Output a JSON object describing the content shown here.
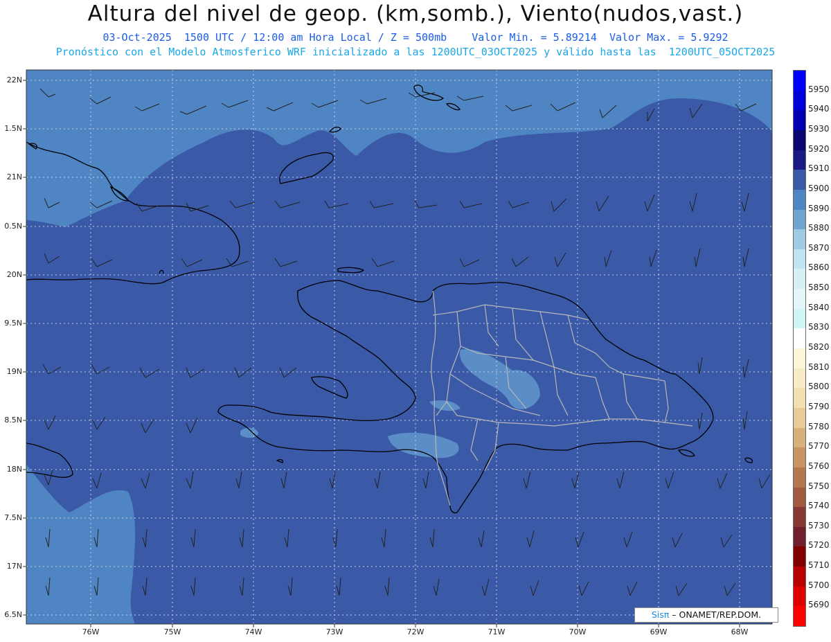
{
  "header": {
    "title": "Altura del nivel de geop. (km,somb.), Viento(nudos,vast.)",
    "subtitle_line1": "03-Oct-2025  1500 UTC / 12:00 am Hora Local / Z = 500mb    Valor Min. = 5.89214  Valor Max. = 5.9292",
    "subtitle_line2": "Pronóstico con el Modelo Atmosferico WRF inicializado a las 1200UTC_03OCT2025 y válido hasta las  1200UTC_05OCT2025"
  },
  "map": {
    "lat_labels": [
      "22N",
      "1.5N",
      "21N",
      "0.5N",
      "20N",
      "9.5N",
      "19N",
      "8.5N",
      "18N",
      "7.5N",
      "17N",
      "6.5N"
    ],
    "lon_labels": [
      "76W",
      "75W",
      "74W",
      "73W",
      "72W",
      "71W",
      "70W",
      "69W",
      "68W"
    ],
    "background_color": "#3a5aa8",
    "high_color": "#4f85c2",
    "pocket_color": "#5b8ec6",
    "coastline_color": "#000000",
    "province_border_color": "#b8b8b8"
  },
  "colorbar": {
    "labels": [
      "5950",
      "5940",
      "5930",
      "5920",
      "5910",
      "5900",
      "5890",
      "5880",
      "5870",
      "5860",
      "5850",
      "5840",
      "5830",
      "5820",
      "5810",
      "5800",
      "5790",
      "5780",
      "5770",
      "5760",
      "5750",
      "5740",
      "5730",
      "5720",
      "5710",
      "5700",
      "5690"
    ],
    "colors": [
      "#0000ff",
      "#0000d8",
      "#0000b0",
      "#080870",
      "#1a1a85",
      "#3a5aa8",
      "#4f85c2",
      "#6fa6d0",
      "#9ecbe3",
      "#c2e4f0",
      "#d8f0f4",
      "#e4f6f8",
      "#d0f4f8",
      "#ffffff",
      "#fdf5d8",
      "#f8ecc6",
      "#f2e0b2",
      "#e8cc98",
      "#d8b07a",
      "#c89462",
      "#b4784e",
      "#a05a40",
      "#883834",
      "#70202a",
      "#800000",
      "#b80000",
      "#e00000",
      "#ff0000"
    ]
  },
  "credit": {
    "sis": "Sisπ",
    "rest": "– ONAMET/REP.DOM."
  }
}
